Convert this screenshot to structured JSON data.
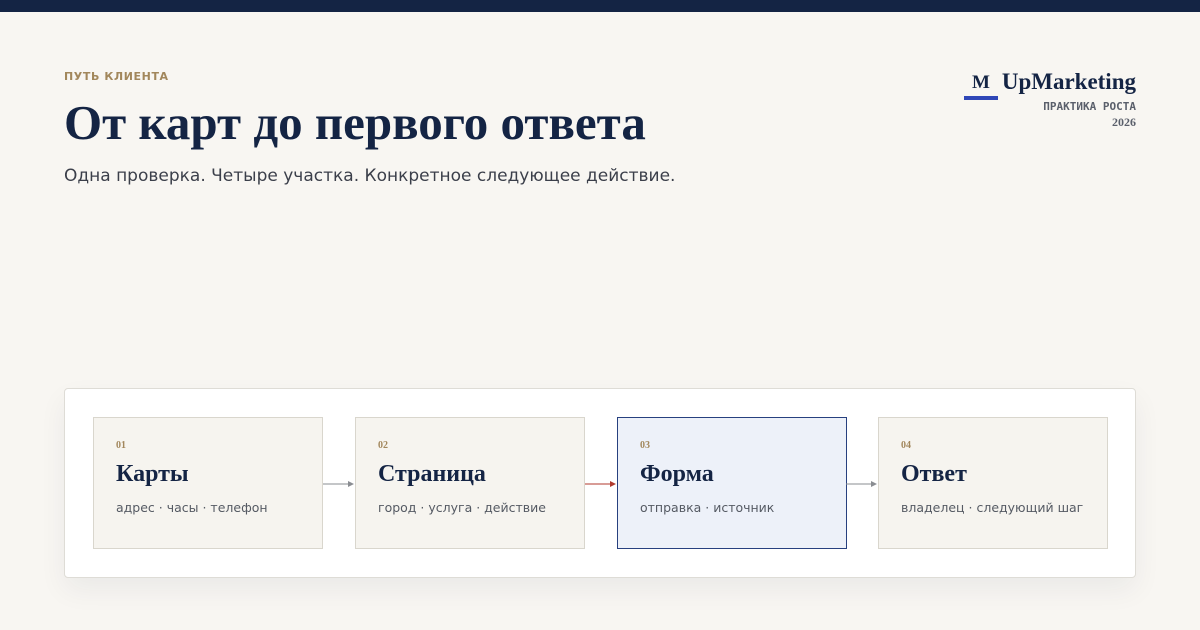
{
  "header": {
    "eyebrow": "ПУТЬ  КЛИЕНТА",
    "title": "От карт до первого ответа",
    "subtitle": "Одна проверка. Четыре участка. Конкретное следующее действие."
  },
  "brand": {
    "mark": "M",
    "name": "UpMarketing",
    "line2": "ПРАКТИКА  РОСТА",
    "line3": "2026"
  },
  "steps": [
    {
      "num": "01",
      "title": "Карты",
      "desc": "адрес · часы · телефон",
      "active": false
    },
    {
      "num": "02",
      "title": "Страница",
      "desc": "город · услуга · действие",
      "active": false
    },
    {
      "num": "03",
      "title": "Форма",
      "desc": "отправка · источник",
      "active": true
    },
    {
      "num": "04",
      "title": "Ответ",
      "desc": "владелец · следующий шаг",
      "active": false
    }
  ],
  "colors": {
    "navy": "#142444",
    "accent_gold": "#a2875c",
    "brand_blue": "#2f47b7",
    "active_border": "#27407f",
    "arrow_gray": "#8a8d92",
    "arrow_red": "#b03a2e"
  }
}
